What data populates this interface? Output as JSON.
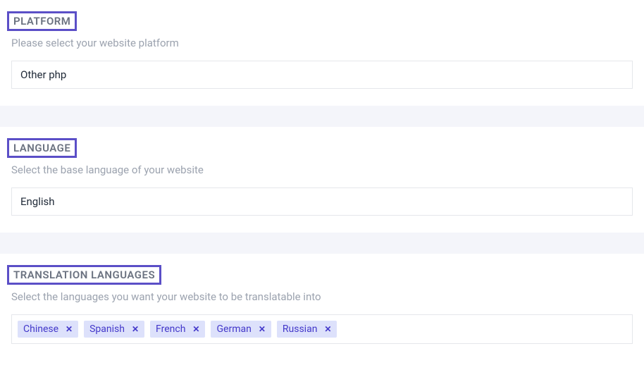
{
  "platform": {
    "title": "PLATFORM",
    "description": "Please select your website platform",
    "selected": "Other php"
  },
  "language": {
    "title": "LANGUAGE",
    "description": "Select the base language of your website",
    "selected": "English"
  },
  "translation_languages": {
    "title": "TRANSLATION LANGUAGES",
    "description": "Select the languages you want your website to be translatable into",
    "tags": [
      "Chinese",
      "Spanish",
      "French",
      "German",
      "Russian"
    ]
  }
}
